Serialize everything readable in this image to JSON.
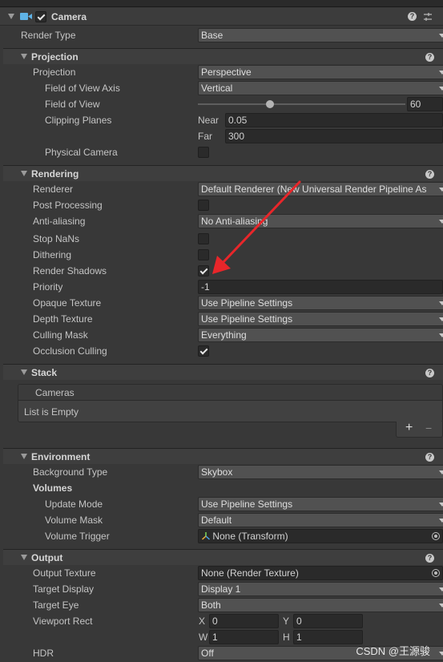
{
  "component": {
    "title": "Camera",
    "enabled": true
  },
  "render_type": {
    "label": "Render Type",
    "value": "Base"
  },
  "projection": {
    "section": "Projection",
    "projection_label": "Projection",
    "projection_value": "Perspective",
    "fov_axis_label": "Field of View Axis",
    "fov_axis_value": "Vertical",
    "fov_label": "Field of View",
    "fov_value": "60",
    "fov_fraction": 0.34,
    "clip_label": "Clipping Planes",
    "near_label": "Near",
    "near_value": "0.05",
    "far_label": "Far",
    "far_value": "300",
    "physical_label": "Physical Camera",
    "physical_checked": false
  },
  "rendering": {
    "section": "Rendering",
    "renderer_label": "Renderer",
    "renderer_value": "Default Renderer (New Universal Render Pipeline As",
    "post_label": "Post Processing",
    "post_checked": false,
    "aa_label": "Anti-aliasing",
    "aa_value": "No Anti-aliasing",
    "nan_label": "Stop NaNs",
    "nan_checked": false,
    "dither_label": "Dithering",
    "dither_checked": false,
    "shadows_label": "Render Shadows",
    "shadows_checked": true,
    "priority_label": "Priority",
    "priority_value": "-1",
    "opaque_label": "Opaque Texture",
    "opaque_value": "Use Pipeline Settings",
    "depth_label": "Depth Texture",
    "depth_value": "Use Pipeline Settings",
    "culling_label": "Culling Mask",
    "culling_value": "Everything",
    "occlusion_label": "Occlusion Culling",
    "occlusion_checked": true
  },
  "stack": {
    "section": "Stack",
    "list_header": "Cameras",
    "empty_text": "List is Empty",
    "add_symbol": "+",
    "remove_symbol": "−"
  },
  "environment": {
    "section": "Environment",
    "bg_label": "Background Type",
    "bg_value": "Skybox",
    "volumes_label": "Volumes",
    "update_label": "Update Mode",
    "update_value": "Use Pipeline Settings",
    "mask_label": "Volume Mask",
    "mask_value": "Default",
    "trigger_label": "Volume Trigger",
    "trigger_value": "None (Transform)"
  },
  "output": {
    "section": "Output",
    "texture_label": "Output Texture",
    "texture_value": "None (Render Texture)",
    "display_label": "Target Display",
    "display_value": "Display 1",
    "eye_label": "Target Eye",
    "eye_value": "Both",
    "viewport_label": "Viewport Rect",
    "x_label": "X",
    "x_value": "0",
    "y_label": "Y",
    "y_value": "0",
    "w_label": "W",
    "w_value": "1",
    "h_label": "H",
    "h_value": "1",
    "hdr_label": "HDR",
    "hdr_value": "Off"
  },
  "watermark": "CSDN @王源骏",
  "colors": {
    "annotation_arrow": "#e8262a",
    "camera_icon": "#5fb3e6"
  }
}
